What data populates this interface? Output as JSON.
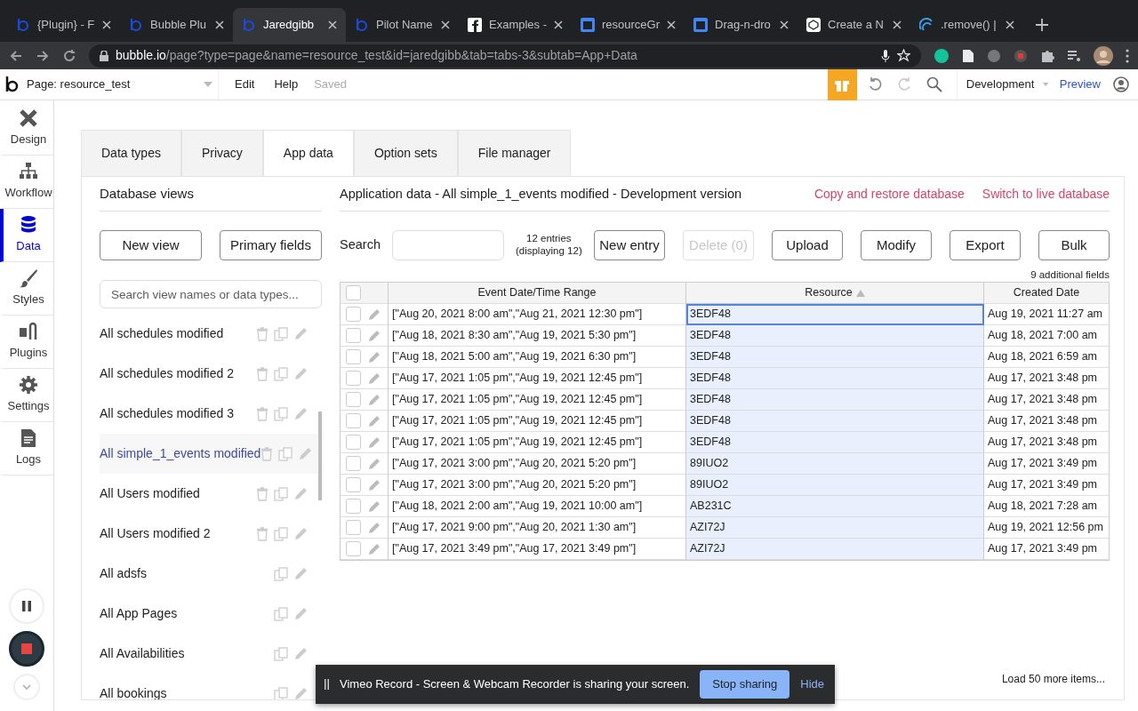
{
  "browser": {
    "tabs": [
      {
        "title": "{Plugin} - F",
        "kind": "bubble",
        "selected": false
      },
      {
        "title": "Bubble Plu",
        "kind": "bubble",
        "selected": false
      },
      {
        "title": "Jaredgibb",
        "kind": "bubble",
        "selected": true
      },
      {
        "title": "Pilot Name",
        "kind": "bubble",
        "selected": false
      },
      {
        "title": "Examples -",
        "kind": "facebook",
        "selected": false
      },
      {
        "title": "resourceGr",
        "kind": "doc",
        "selected": false
      },
      {
        "title": "Drag-n-dro",
        "kind": "doc",
        "selected": false
      },
      {
        "title": "Create a N",
        "kind": "cube",
        "selected": false
      },
      {
        "title": ".remove() |",
        "kind": "wave",
        "selected": false
      }
    ],
    "url_host": "bubble.io",
    "url_path": "/page?type=page&name=resource_test&id=jaredgibb&tab=tabs-3&subtab=App+Data"
  },
  "app_bar": {
    "page": "Page: resource_test",
    "menu": [
      "Edit",
      "Help"
    ],
    "save_status": "Saved",
    "version": "Development",
    "preview": "Preview"
  },
  "sidebar": {
    "items": [
      {
        "label": "Design",
        "kind": "design",
        "selected": false
      },
      {
        "label": "Workflow",
        "kind": "workflow",
        "selected": false
      },
      {
        "label": "Data",
        "kind": "data",
        "selected": true
      },
      {
        "label": "Styles",
        "kind": "styles",
        "selected": false
      },
      {
        "label": "Plugins",
        "kind": "plugins",
        "selected": false
      },
      {
        "label": "Settings",
        "kind": "settings",
        "selected": false
      },
      {
        "label": "Logs",
        "kind": "logs",
        "selected": false
      }
    ]
  },
  "tabs": [
    {
      "label": "Data types",
      "selected": false
    },
    {
      "label": "Privacy",
      "selected": false
    },
    {
      "label": "App data",
      "selected": true
    },
    {
      "label": "Option sets",
      "selected": false
    },
    {
      "label": "File manager",
      "selected": false
    }
  ],
  "views": {
    "title": "Database views",
    "buttons": [
      "New view",
      "Primary fields"
    ],
    "search": {
      "placeholder": "Search view names or data types..."
    },
    "items": [
      {
        "label": "All schedules modified",
        "selected": false,
        "deletable": true
      },
      {
        "label": "All schedules modified 2",
        "selected": false,
        "deletable": true
      },
      {
        "label": "All schedules modified 3",
        "selected": false,
        "deletable": true
      },
      {
        "label": "All simple_1_events modified",
        "selected": true,
        "deletable": true
      },
      {
        "label": "All Users modified",
        "selected": false,
        "deletable": true
      },
      {
        "label": "All Users modified 2",
        "selected": false,
        "deletable": true
      },
      {
        "label": "All adsfs",
        "selected": false,
        "deletable": false
      },
      {
        "label": "All App Pages",
        "selected": false,
        "deletable": false
      },
      {
        "label": "All Availabilities",
        "selected": false,
        "deletable": false
      },
      {
        "label": "All bookings",
        "selected": false,
        "deletable": false
      }
    ]
  },
  "data": {
    "title": "Application data - All simple_1_events modified - Development version",
    "links": [
      "Copy and restore database",
      "Switch to live database"
    ],
    "search_label": "Search",
    "entries": "12 entries",
    "displaying": "(displaying 12)",
    "buttons": [
      {
        "label": "New entry",
        "disabled": false
      },
      {
        "label": "Delete (0)",
        "disabled": true
      },
      {
        "label": "Upload",
        "disabled": false
      },
      {
        "label": "Modify",
        "disabled": false
      },
      {
        "label": "Export",
        "disabled": false
      },
      {
        "label": "Bulk",
        "disabled": false
      }
    ],
    "additional_fields": "9 additional fields",
    "all_checked": false,
    "columns": [
      {
        "label": "Event Date/Time Range",
        "selected": false,
        "sorted": false
      },
      {
        "label": "Resource",
        "selected": true,
        "sorted": true
      },
      {
        "label": "Created Date",
        "selected": false,
        "sorted": false
      }
    ],
    "rows": [
      {
        "cells": [
          "[\"Aug 20, 2021 8:00 am\",\"Aug 21, 2021 12:30 pm\"]",
          "3EDF48",
          "Aug 19, 2021 11:27 am"
        ],
        "focused": true,
        "checked": false
      },
      {
        "cells": [
          "[\"Aug 18, 2021 8:30 am\",\"Aug 19, 2021 5:30 pm\"]",
          "3EDF48",
          "Aug 18, 2021 7:00 am"
        ],
        "focused": false,
        "checked": false
      },
      {
        "cells": [
          "[\"Aug 18, 2021 5:00 am\",\"Aug 19, 2021 6:30 pm\"]",
          "3EDF48",
          "Aug 18, 2021 6:59 am"
        ],
        "focused": false,
        "checked": false
      },
      {
        "cells": [
          "[\"Aug 17, 2021 1:05 pm\",\"Aug 19, 2021 12:45 pm\"]",
          "3EDF48",
          "Aug 17, 2021 3:48 pm"
        ],
        "focused": false,
        "checked": false
      },
      {
        "cells": [
          "[\"Aug 17, 2021 1:05 pm\",\"Aug 19, 2021 12:45 pm\"]",
          "3EDF48",
          "Aug 17, 2021 3:48 pm"
        ],
        "focused": false,
        "checked": false
      },
      {
        "cells": [
          "[\"Aug 17, 2021 1:05 pm\",\"Aug 19, 2021 12:45 pm\"]",
          "3EDF48",
          "Aug 17, 2021 3:48 pm"
        ],
        "focused": false,
        "checked": false
      },
      {
        "cells": [
          "[\"Aug 17, 2021 1:05 pm\",\"Aug 19, 2021 12:45 pm\"]",
          "3EDF48",
          "Aug 17, 2021 3:48 pm"
        ],
        "focused": false,
        "checked": false
      },
      {
        "cells": [
          "[\"Aug 17, 2021 3:00 pm\",\"Aug 20, 2021 5:20 pm\"]",
          "89IUO2",
          "Aug 17, 2021 3:49 pm"
        ],
        "focused": false,
        "checked": false
      },
      {
        "cells": [
          "[\"Aug 17, 2021 3:00 pm\",\"Aug 20, 2021 5:20 pm\"]",
          "89IUO2",
          "Aug 17, 2021 3:49 pm"
        ],
        "focused": false,
        "checked": false
      },
      {
        "cells": [
          "[\"Aug 18, 2021 2:00 am\",\"Aug 19, 2021 10:00 am\"]",
          "AB231C",
          "Aug 18, 2021 7:28 am"
        ],
        "focused": false,
        "checked": false
      },
      {
        "cells": [
          "[\"Aug 17, 2021 9:00 pm\",\"Aug 20, 2021 1:30 am\"]",
          "AZI72J",
          "Aug 19, 2021 12:56 pm"
        ],
        "focused": false,
        "checked": false
      },
      {
        "cells": [
          "[\"Aug 17, 2021 3:49 pm\",\"Aug 17, 2021 3:49 pm\"]",
          "AZI72J",
          "Aug 17, 2021 3:49 pm"
        ],
        "focused": false,
        "checked": false
      }
    ],
    "load_more": "Load 50 more items..."
  },
  "notification": {
    "text": "Vimeo Record - Screen & Webcam Recorder is sharing your screen.",
    "buttons": [
      "Stop sharing",
      "Hide"
    ]
  }
}
